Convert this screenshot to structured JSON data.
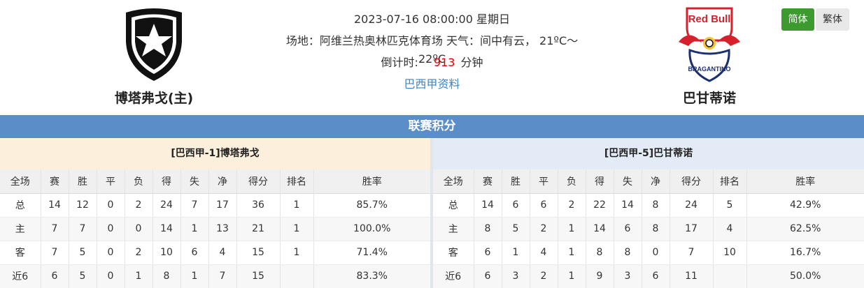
{
  "match": {
    "datetime": "2023-07-16 08:00:00 星期日",
    "venue_weather": "场地：阿维兰热奥林匹克体育场 天气：间中有云， 21ºC～22ºC",
    "countdown_label": "倒计时:",
    "countdown_value": "913",
    "countdown_unit": "分钟",
    "league_link": "巴西甲资料"
  },
  "home_team": {
    "name": "博塔弗戈(主)",
    "logo_icon": "star-shield-icon"
  },
  "away_team": {
    "name": "巴甘蒂诺",
    "logo_icon": "redbull-bragantino-icon",
    "logo_text_top": "Red Bull",
    "logo_text_ring": "BRAGANTINO"
  },
  "lang": {
    "simplified": "简体",
    "traditional": "繁体"
  },
  "section_title": "联赛积分",
  "columns": [
    "全场",
    "赛",
    "胜",
    "平",
    "负",
    "得",
    "失",
    "净",
    "得分",
    "排名",
    "胜率"
  ],
  "home_panel": {
    "title": "[巴西甲-1]博塔弗戈",
    "rows": [
      [
        "总",
        "14",
        "12",
        "0",
        "2",
        "24",
        "7",
        "17",
        "36",
        "1",
        "85.7%"
      ],
      [
        "主",
        "7",
        "7",
        "0",
        "0",
        "14",
        "1",
        "13",
        "21",
        "1",
        "100.0%"
      ],
      [
        "客",
        "7",
        "5",
        "0",
        "2",
        "10",
        "6",
        "4",
        "15",
        "1",
        "71.4%"
      ],
      [
        "近6",
        "6",
        "5",
        "0",
        "1",
        "8",
        "1",
        "7",
        "15",
        "",
        "83.3%"
      ]
    ]
  },
  "away_panel": {
    "title": "[巴西甲-5]巴甘蒂诺",
    "rows": [
      [
        "总",
        "14",
        "6",
        "6",
        "2",
        "22",
        "14",
        "8",
        "24",
        "5",
        "42.9%"
      ],
      [
        "主",
        "8",
        "5",
        "2",
        "1",
        "14",
        "6",
        "8",
        "17",
        "4",
        "62.5%"
      ],
      [
        "客",
        "6",
        "1",
        "4",
        "1",
        "8",
        "8",
        "0",
        "7",
        "10",
        "16.7%"
      ],
      [
        "近6",
        "6",
        "3",
        "2",
        "1",
        "9",
        "3",
        "6",
        "11",
        "",
        "50.0%"
      ]
    ]
  },
  "colors": {
    "header_bar": "#5b8ec9",
    "home_red": "#d00000",
    "away_blue": "#1a3fa8",
    "countdown": "#e10000",
    "link": "#3a86c8",
    "lang_active": "#3c9a2f"
  }
}
